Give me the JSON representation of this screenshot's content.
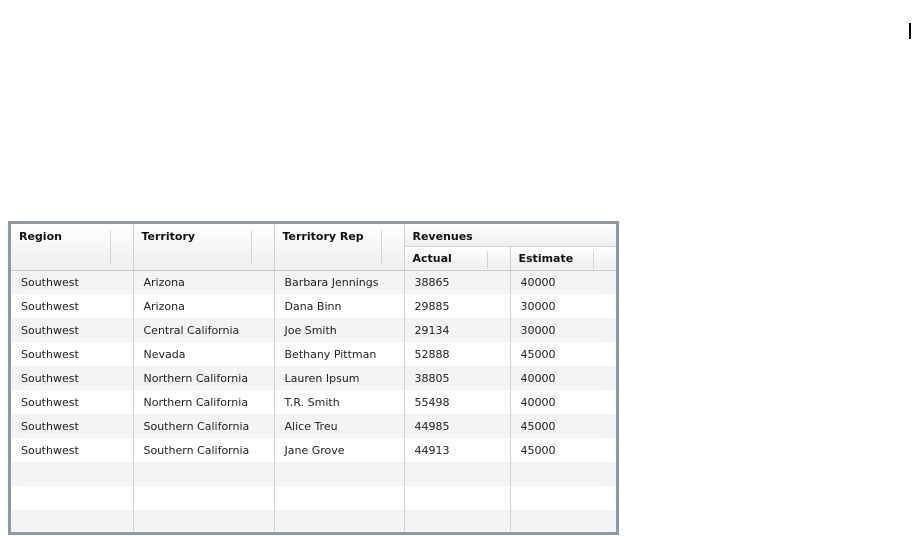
{
  "grid": {
    "headers": {
      "region": "Region",
      "territory": "Territory",
      "territory_rep": "Territory Rep",
      "revenues": "Revenues",
      "actual": "Actual",
      "estimate": "Estimate"
    },
    "rows": [
      {
        "region": "Southwest",
        "territory": "Arizona",
        "rep": "Barbara Jennings",
        "actual": "38865",
        "estimate": "40000"
      },
      {
        "region": "Southwest",
        "territory": "Arizona",
        "rep": "Dana Binn",
        "actual": "29885",
        "estimate": "30000"
      },
      {
        "region": "Southwest",
        "territory": "Central California",
        "rep": "Joe Smith",
        "actual": "29134",
        "estimate": "30000"
      },
      {
        "region": "Southwest",
        "territory": "Nevada",
        "rep": "Bethany Pittman",
        "actual": "52888",
        "estimate": "45000"
      },
      {
        "region": "Southwest",
        "territory": "Northern California",
        "rep": "Lauren Ipsum",
        "actual": "38805",
        "estimate": "40000"
      },
      {
        "region": "Southwest",
        "territory": "Northern California",
        "rep": "T.R. Smith",
        "actual": "55498",
        "estimate": "40000"
      },
      {
        "region": "Southwest",
        "territory": "Southern California",
        "rep": "Alice Treu",
        "actual": "44985",
        "estimate": "45000"
      },
      {
        "region": "Southwest",
        "territory": "Southern California",
        "rep": "Jane Grove",
        "actual": "44913",
        "estimate": "45000"
      }
    ],
    "empty_row_count": 3,
    "colors": {
      "frame_border": "#8b9aa5",
      "row_alt": "#f4f4f4",
      "row_base": "#ffffff"
    }
  }
}
